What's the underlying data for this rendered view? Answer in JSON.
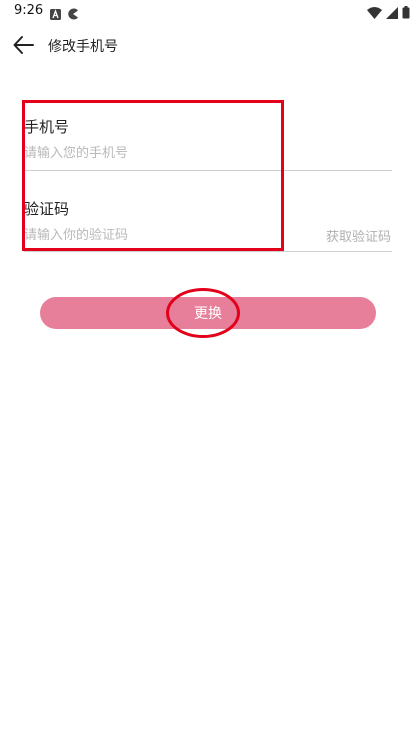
{
  "status_bar": {
    "time": "9:26"
  },
  "header": {
    "title": "修改手机号"
  },
  "form": {
    "phone": {
      "label": "手机号",
      "placeholder": "请输入您的手机号",
      "value": ""
    },
    "code": {
      "label": "验证码",
      "placeholder": "请输入你的验证码",
      "value": "",
      "get_code_label": "获取验证码"
    }
  },
  "submit": {
    "label": "更换"
  },
  "colors": {
    "accent": "#e77f9b",
    "annotation": "#e2001a"
  },
  "icons": [
    "back-arrow-icon",
    "wifi-icon",
    "signal-icon",
    "battery-icon"
  ]
}
